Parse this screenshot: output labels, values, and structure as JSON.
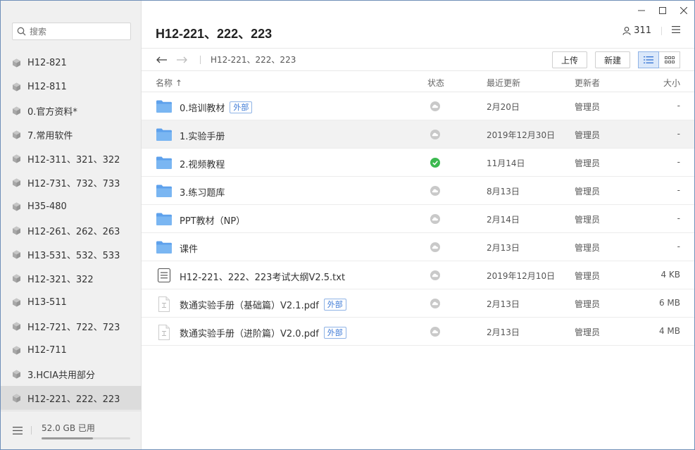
{
  "sidebar": {
    "search_placeholder": "搜索",
    "items": [
      {
        "label": "H12-821"
      },
      {
        "label": "H12-811"
      },
      {
        "label": "0.官方资料*"
      },
      {
        "label": "7.常用软件"
      },
      {
        "label": "H12-311、321、322"
      },
      {
        "label": "H12-731、732、733"
      },
      {
        "label": "H35-480"
      },
      {
        "label": "H12-261、262、263"
      },
      {
        "label": "H13-531、532、533"
      },
      {
        "label": "H12-321、322"
      },
      {
        "label": "H13-511"
      },
      {
        "label": "H12-721、722、723"
      },
      {
        "label": "H12-711"
      },
      {
        "label": "3.HCIA共用部分"
      },
      {
        "label": "H12-221、222、223"
      }
    ],
    "selected_index": 14,
    "storage_text": "52.0 GB 已用",
    "storage_fraction": 0.58
  },
  "header": {
    "title": "H12-221、222、223",
    "member_count": "311"
  },
  "toolbar": {
    "breadcrumb": "H12-221、222、223",
    "upload_label": "上传",
    "new_label": "新建"
  },
  "columns": {
    "name": "名称 ↑",
    "status": "状态",
    "updated": "最近更新",
    "updater": "更新者",
    "size": "大小"
  },
  "files": [
    {
      "name": "0.培训教材",
      "type": "folder",
      "badge": "外部",
      "status": "cloud",
      "date": "2月20日",
      "owner": "管理员",
      "size": "-"
    },
    {
      "name": "1.实验手册",
      "type": "folder",
      "badge": "",
      "status": "cloud",
      "date": "2019年12月30日",
      "owner": "管理员",
      "size": "-"
    },
    {
      "name": "2.视频教程",
      "type": "folder",
      "badge": "",
      "status": "synced",
      "date": "11月14日",
      "owner": "管理员",
      "size": "-"
    },
    {
      "name": "3.练习题库",
      "type": "folder",
      "badge": "",
      "status": "cloud",
      "date": "8月13日",
      "owner": "管理员",
      "size": "-"
    },
    {
      "name": "PPT教材（NP）",
      "type": "folder",
      "badge": "",
      "status": "cloud",
      "date": "2月14日",
      "owner": "管理员",
      "size": "-"
    },
    {
      "name": "课件",
      "type": "folder",
      "badge": "",
      "status": "cloud",
      "date": "2月13日",
      "owner": "管理员",
      "size": "-"
    },
    {
      "name": "H12-221、222、223考试大纲V2.5.txt",
      "type": "txt",
      "badge": "",
      "status": "cloud",
      "date": "2019年12月10日",
      "owner": "管理员",
      "size": "4 KB"
    },
    {
      "name": "数通实验手册（基础篇）V2.1.pdf",
      "type": "pdf",
      "badge": "外部",
      "status": "cloud",
      "date": "2月13日",
      "owner": "管理员",
      "size": "6 MB"
    },
    {
      "name": "数通实验手册（进阶篇）V2.0.pdf",
      "type": "pdf",
      "badge": "外部",
      "status": "cloud",
      "date": "2月13日",
      "owner": "管理员",
      "size": "4 MB"
    }
  ],
  "selected_row": 1,
  "colors": {
    "folder": "#5ea1ec",
    "synced": "#3cb950",
    "badge": "#3d7ad6"
  }
}
